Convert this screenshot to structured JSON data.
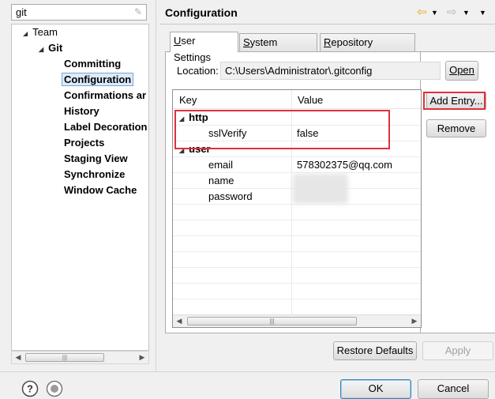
{
  "filter": {
    "value": "git",
    "clear_icon": "eraser-icon"
  },
  "tree": {
    "team": "Team",
    "git": "Git",
    "children": [
      "Committing",
      "Configuration",
      "Confirmations and Warnings",
      "History",
      "Label Decorations",
      "Projects",
      "Staging View",
      "Synchronize",
      "Window Cache"
    ],
    "children_visible": [
      "Committing",
      "Configuration",
      "Confirmations ar",
      "History",
      "Label Decoration",
      "Projects",
      "Staging View",
      "Synchronize",
      "Window Cache"
    ],
    "selected": "Configuration"
  },
  "header": {
    "title": "Configuration",
    "back_icon": "back-arrow-icon",
    "forward_icon": "forward-arrow-icon",
    "menu_icon": "view-menu-icon"
  },
  "tabs": [
    {
      "label": "User Settings",
      "mnemonic": "U",
      "rest": "ser Settings",
      "active": true
    },
    {
      "label": "System Settings",
      "mnemonic": "S",
      "rest": "ystem Settings",
      "active": false
    },
    {
      "label": "Repository Settings",
      "mnemonic": "R",
      "rest": "epository Settings",
      "active": false
    }
  ],
  "location": {
    "label": "Location:",
    "value": "C:\\Users\\Administrator\\.gitconfig",
    "open_label": "Open"
  },
  "table": {
    "headers": {
      "key": "Key",
      "value": "Value"
    },
    "rows": [
      {
        "key": "http",
        "value": "",
        "section": true
      },
      {
        "key": "sslVerify",
        "value": "false",
        "section": false
      },
      {
        "key": "user",
        "value": "",
        "section": true
      },
      {
        "key": "email",
        "value": "578302375@qq.com",
        "section": false
      },
      {
        "key": "name",
        "value": "",
        "section": false
      },
      {
        "key": "password",
        "value": "",
        "section": false
      }
    ]
  },
  "side_buttons": {
    "add": "Add Entry...",
    "remove": "Remove"
  },
  "page_buttons": {
    "restore": "Restore Defaults",
    "apply": "Apply"
  },
  "dialog_buttons": {
    "ok": "OK",
    "cancel": "Cancel"
  },
  "footer_icons": [
    "help-icon",
    "import-export-icon"
  ],
  "colors": {
    "highlight": "#e0303a",
    "selection": "#dceafc",
    "nav_arrow": "#e8a628"
  }
}
